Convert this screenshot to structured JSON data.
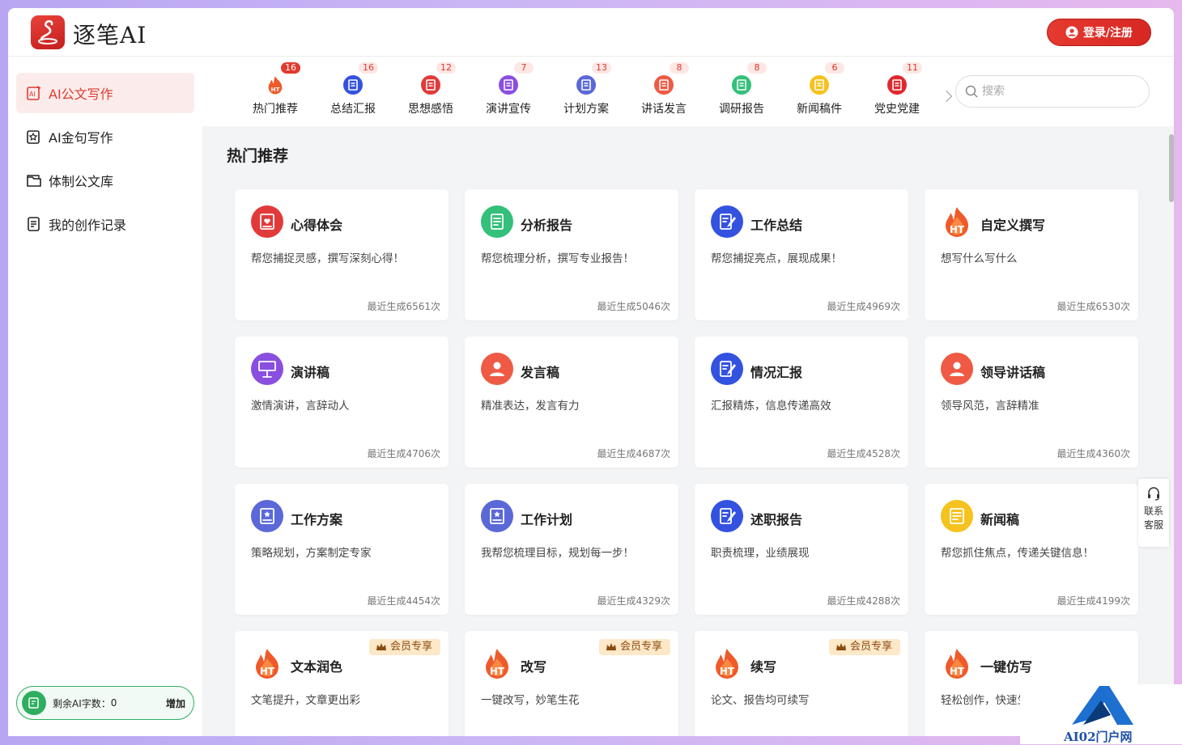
{
  "app": {
    "logo_text": "逐笔AI",
    "login_label": "登录/注册"
  },
  "sidebar": {
    "items": [
      {
        "label": "AI公文写作",
        "icon": "ai-doc-icon",
        "active": true
      },
      {
        "label": "AI金句写作",
        "icon": "ai-quote-icon",
        "active": false
      },
      {
        "label": "体制公文库",
        "icon": "folder-icon",
        "active": false
      },
      {
        "label": "我的创作记录",
        "icon": "record-icon",
        "active": false
      }
    ],
    "quota": {
      "label": "剩余AI字数：",
      "value": "0",
      "add_label": "增加"
    }
  },
  "categories": [
    {
      "label": "热门推荐",
      "badge": "16",
      "hot": true,
      "color": "#ef5a2a"
    },
    {
      "label": "总结汇报",
      "badge": "16",
      "hot": false,
      "color": "#3452e0"
    },
    {
      "label": "思想感悟",
      "badge": "12",
      "hot": false,
      "color": "#e23a3a"
    },
    {
      "label": "演讲宣传",
      "badge": "7",
      "hot": false,
      "color": "#8a4fe0"
    },
    {
      "label": "计划方案",
      "badge": "13",
      "hot": false,
      "color": "#5a68d8"
    },
    {
      "label": "讲话发言",
      "badge": "8",
      "hot": false,
      "color": "#ef5a45"
    },
    {
      "label": "调研报告",
      "badge": "8",
      "hot": false,
      "color": "#33c07a"
    },
    {
      "label": "新闻稿件",
      "badge": "6",
      "hot": false,
      "color": "#f5c21f"
    },
    {
      "label": "党史党建",
      "badge": "11",
      "hot": false,
      "color": "#e0282f"
    }
  ],
  "search": {
    "placeholder": "搜索"
  },
  "section": {
    "title": "热门推荐"
  },
  "cards": [
    {
      "title": "心得体会",
      "desc": "帮您捕捉灵感，撰写深刻心得！",
      "count": "最近生成6561次",
      "color": "#e23a3a",
      "icon": "heart-doc-icon"
    },
    {
      "title": "分析报告",
      "desc": "帮您梳理分析，撰写专业报告！",
      "count": "最近生成5046次",
      "color": "#33c07a",
      "icon": "report-icon"
    },
    {
      "title": "工作总结",
      "desc": "帮您捕捉亮点，展现成果！",
      "count": "最近生成4969次",
      "color": "#3452e0",
      "icon": "edit-doc-icon"
    },
    {
      "title": "自定义撰写",
      "desc": "想写什么写什么",
      "count": "最近生成6530次",
      "color": "#ef5a2a",
      "icon": "ht-flame-icon"
    },
    {
      "title": "演讲稿",
      "desc": "激情演讲，言辞动人",
      "count": "最近生成4706次",
      "color": "#8a4fe0",
      "icon": "podium-icon"
    },
    {
      "title": "发言稿",
      "desc": "精准表达，发言有力",
      "count": "最近生成4687次",
      "color": "#ef5a45",
      "icon": "speaker-icon"
    },
    {
      "title": "情况汇报",
      "desc": "汇报精炼，信息传递高效",
      "count": "最近生成4528次",
      "color": "#3452e0",
      "icon": "edit-doc-icon"
    },
    {
      "title": "领导讲话稿",
      "desc": "领导风范，言辞精准",
      "count": "最近生成4360次",
      "color": "#ef5a45",
      "icon": "speaker-icon"
    },
    {
      "title": "工作方案",
      "desc": "策略规划，方案制定专家",
      "count": "最近生成4454次",
      "color": "#5a68d8",
      "icon": "plan-icon"
    },
    {
      "title": "工作计划",
      "desc": "我帮您梳理目标，规划每一步！",
      "count": "最近生成4329次",
      "color": "#5a68d8",
      "icon": "plan-icon"
    },
    {
      "title": "述职报告",
      "desc": "职责梳理，业绩展现",
      "count": "最近生成4288次",
      "color": "#3452e0",
      "icon": "edit-doc-icon"
    },
    {
      "title": "新闻稿",
      "desc": "帮您抓住焦点，传递关键信息！",
      "count": "最近生成4199次",
      "color": "#f5c21f",
      "icon": "news-icon"
    },
    {
      "title": "文本润色",
      "desc": "文笔提升，文章更出彩",
      "count": "",
      "color": "#ef5a2a",
      "icon": "ht-flame-icon",
      "vip": "会员专享"
    },
    {
      "title": "改写",
      "desc": "一键改写，妙笔生花",
      "count": "",
      "color": "#ef5a2a",
      "icon": "ht-flame-icon",
      "vip": "会员专享"
    },
    {
      "title": "续写",
      "desc": "论文、报告均可续写",
      "count": "",
      "color": "#ef5a2a",
      "icon": "ht-flame-icon",
      "vip": "会员专享"
    },
    {
      "title": "一键仿写",
      "desc": "轻松创作，快速生",
      "count": "",
      "color": "#ef5a2a",
      "icon": "ht-flame-icon"
    }
  ],
  "support": {
    "line1": "联系",
    "line2": "客服"
  },
  "watermark": {
    "text": "AI02门户网"
  }
}
